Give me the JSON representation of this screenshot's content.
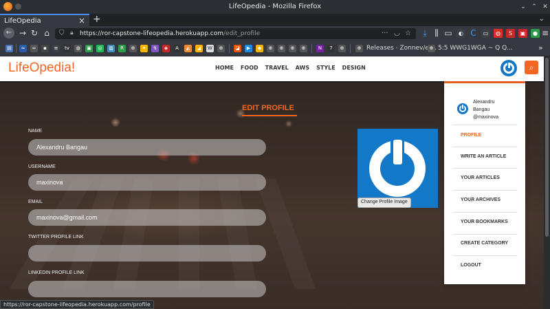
{
  "browser": {
    "window_title": "LifeOpedia - Mozilla Firefox",
    "tab_title": "LifeOpedia",
    "url_host": "https://ror-capstone-lifeopedia.herokuapp.com",
    "url_path": "/edit_profile",
    "bookmarks": {
      "releases": "Releases · Zonnev/el...",
      "wwg": "5:5 WWG1WGA ~ Q Q..."
    },
    "status_url": "https://ror-capstone-lifeopedia.herokuapp.com/profile"
  },
  "site": {
    "logo": "LifeOpedia!",
    "nav": [
      "HOME",
      "FOOD",
      "TRAVEL",
      "AWS",
      "STYLE",
      "DESIGN"
    ]
  },
  "form": {
    "title": "EDIT PROFILE",
    "name_label": "NAME",
    "name_value": "Alexandru Bangau",
    "username_label": "USERNAME",
    "username_value": "maxinova",
    "email_label": "EMAIL",
    "email_value": "maxinova@gmail.com",
    "twitter_label": "TWITTER PROFILE LINK",
    "twitter_value": "",
    "linkedin_label": "LINKEDIN PROFILE LINK",
    "linkedin_value": "",
    "change_image": "Change Profile Image"
  },
  "dropdown": {
    "user_name_1": "Alexandru",
    "user_name_2": "Bangau",
    "user_handle": "@maxinova",
    "items": [
      "PROFILE",
      "WRITE AN ARTICLE",
      "YOUR ARTICLES",
      "YOUR ARCHIVES",
      "YOUR BOOKMARKS",
      "CREATE CATEGORY",
      "LOGOUT"
    ]
  },
  "colors": {
    "accent": "#f26522",
    "avatar_blue": "#1276c4"
  }
}
